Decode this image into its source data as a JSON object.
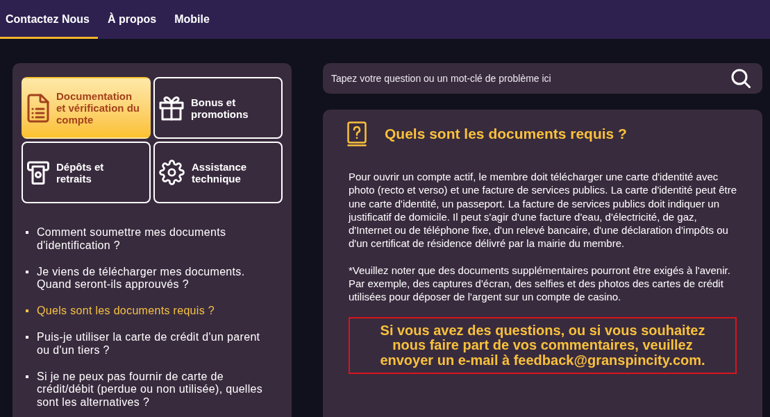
{
  "nav": {
    "tabs": [
      {
        "label": "Contactez Nous",
        "selected": true
      },
      {
        "label": "À propos",
        "selected": false
      },
      {
        "label": "Mobile",
        "selected": false
      }
    ]
  },
  "categories": [
    {
      "label": "Documentation et vérification du compte",
      "selected": true
    },
    {
      "label": "Bonus et promotions",
      "selected": false
    },
    {
      "label": "Dépôts et retraits",
      "selected": false
    },
    {
      "label": "Assistance technique",
      "selected": false
    }
  ],
  "questions": [
    {
      "text": "Comment soumettre mes documents d'identification ?",
      "selected": false
    },
    {
      "text": "Je viens de télécharger mes documents. Quand seront-ils approuvés ?",
      "selected": false
    },
    {
      "text": "Quels sont les documents requis ?",
      "selected": true
    },
    {
      "text": "Puis-je utiliser la carte de crédit d'un parent ou d'un tiers ?",
      "selected": false
    },
    {
      "text": "Si je ne peux pas fournir de carte de crédit/débit (perdue ou non utilisée), quelles sont les alternatives ?",
      "selected": false
    }
  ],
  "search": {
    "placeholder": "Tapez votre question ou un mot-clé de problème ici"
  },
  "article": {
    "title": "Quels sont les documents requis ?",
    "paragraphs": [
      "Pour ouvrir un compte actif, le membre doit télécharger une carte d'identité avec photo (recto et verso) et une facture de services publics. La carte d'identité peut être une carte d'identité, un passeport. La facture de services publics doit indiquer un justificatif de domicile. Il peut s'agir d'une facture d'eau, d'électricité, de gaz, d'Internet ou de téléphone fixe, d'un relevé bancaire, d'une déclaration d'impôts ou d'un certificat de résidence délivré par la mairie du membre.",
      "*Veuillez noter que des documents supplémentaires pourront être exigés à l'avenir. Par exemple, des captures d'écran, des selfies et des photos des cartes de crédit utilisées pour déposer de l'argent sur un compte de casino."
    ],
    "notice": "Si vous avez des questions, ou si vous souhaitez nous faire part de vos commentaires, veuillez envoyer un e-mail à feedback@granspincity.com."
  }
}
